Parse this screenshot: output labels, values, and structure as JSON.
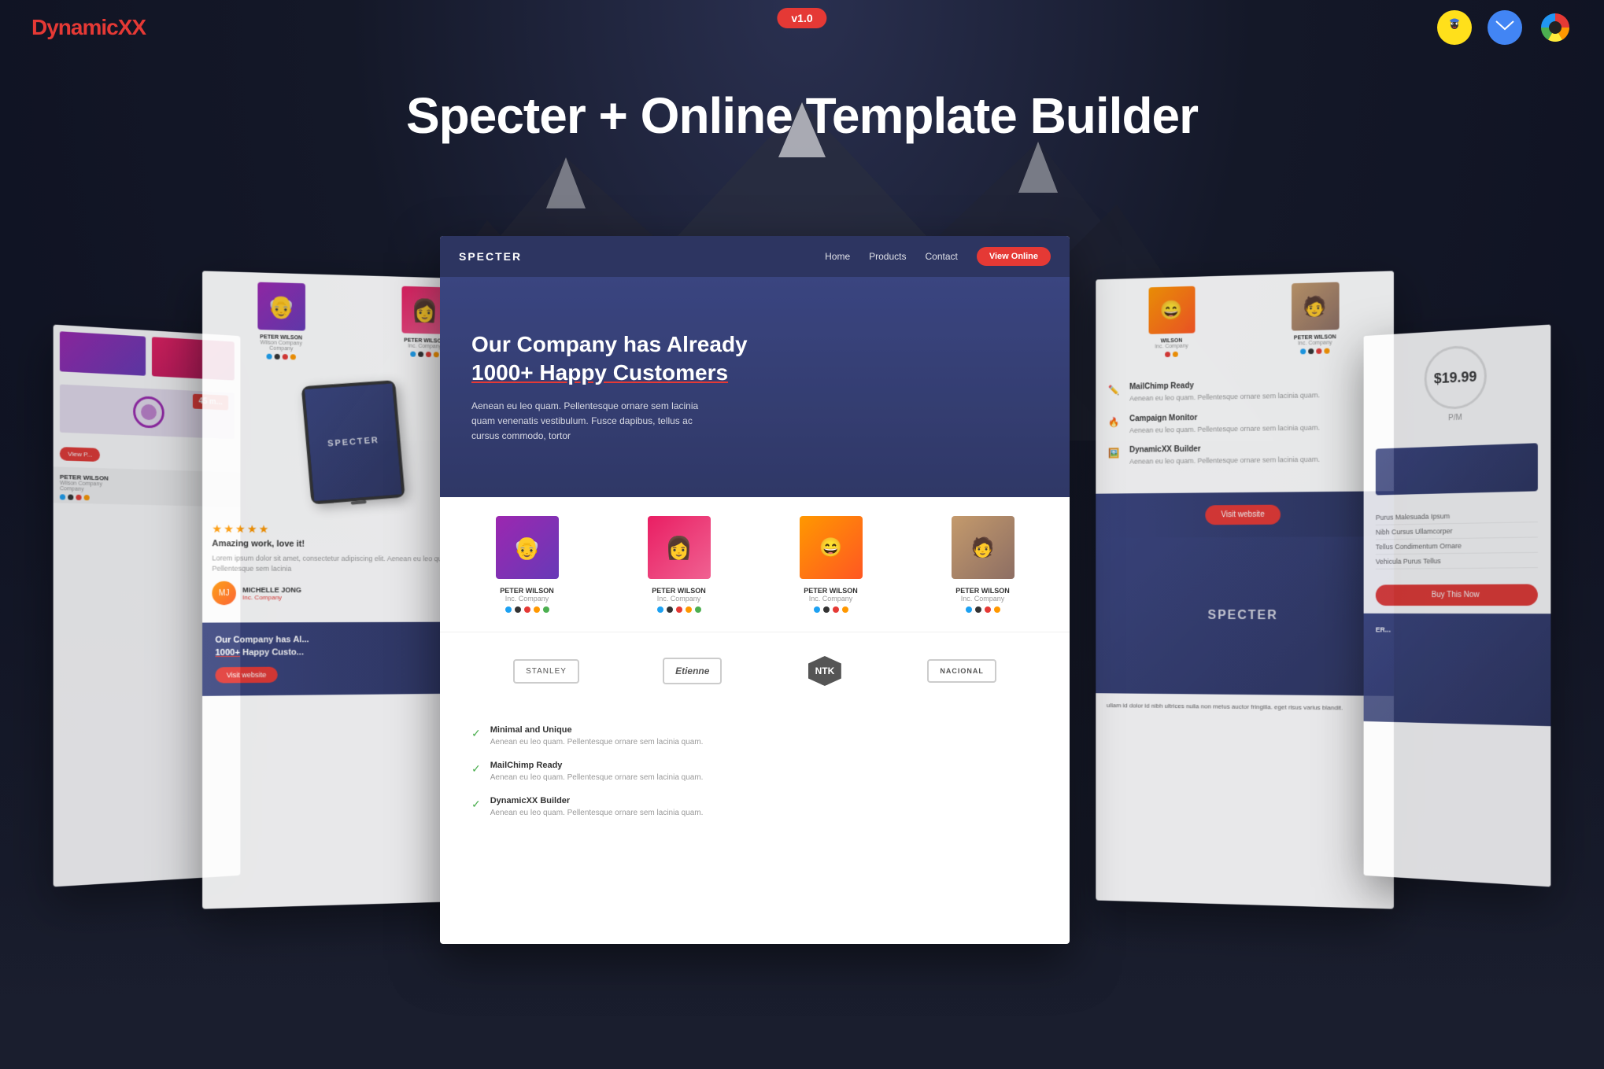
{
  "header": {
    "logo_prefix": "Dynamic",
    "logo_suffix": "XX",
    "version": "v1.0"
  },
  "main_title": "Specter + Online Template Builder",
  "center_card": {
    "nav": {
      "logo": "SPECTER",
      "links": [
        "Home",
        "Products",
        "Contact"
      ],
      "cta": "View Online"
    },
    "hero": {
      "title_line1": "Our Company has Already",
      "title_line2": "1000+ Happy Customers",
      "text": "Aenean eu leo quam. Pellentesque ornare sem lacinia quam venenatis vestibulum. Fusce dapibus, tellus ac cursus commodo, tortor"
    },
    "team": [
      {
        "name": "PETER WILSON",
        "company": "Inc. Company"
      },
      {
        "name": "PETER WILSON",
        "company": "Inc. Company"
      },
      {
        "name": "PETER WILSON",
        "company": "Inc. Company"
      },
      {
        "name": "PETER WILSON",
        "company": "Inc. Company"
      }
    ],
    "brands": [
      "STANLEY",
      "Etienne",
      "NTK",
      "NACIONAL"
    ],
    "features": [
      {
        "title": "Minimal and Unique",
        "text": "Aenean eu leo quam. Pellentesque ornare sem lacinia quam."
      },
      {
        "title": "MailChimp Ready",
        "text": "Aenean eu leo quam. Pellentesque ornare sem lacinia quam."
      },
      {
        "title": "DynamicXX Builder",
        "text": "Aenean eu leo quam. Pellentesque ornare sem lacinia quam."
      }
    ]
  },
  "left_card": {
    "review": {
      "stars": "★★★★★",
      "title": "Amazing work, love it!",
      "text": "Lorem ipsum dolor sit amet, consectetur adipiscing elit. Aenean eu leo quam. Pellentesque sem lacinia",
      "reviewer_name": "MICHELLE JONG",
      "reviewer_company": "Inc. Company"
    },
    "footer": {
      "title_line1": "Our Company has Al...",
      "title_line2": "1000+ Happy Custo...",
      "btn": "Visit website"
    }
  },
  "right_card": {
    "features": [
      {
        "icon": "✏️",
        "title": "MailChimp Ready",
        "text": "Aenean eu leo quam. Pellentesque ornare sem lacinia quam."
      },
      {
        "icon": "🔥",
        "title": "Campaign Monitor",
        "text": "Aenean eu leo quam. Pellentesque ornare sem lacinia quam."
      },
      {
        "icon": "🖼️",
        "title": "DynamicXX Builder",
        "text": "Aenean eu leo quam. Pellentesque ornare sem lacinia quam."
      }
    ],
    "btn": "Visit website",
    "device_label": "SPECTER"
  },
  "far_right_card": {
    "price": "$19.99",
    "period": "P/M",
    "features": [
      "Purus Malesuada Ipsum",
      "Nibh Cursus Ullamcorper",
      "Tellus Condimentum Ornare",
      "Vehicula Purus Tellus"
    ],
    "buy_btn": "Buy This Now"
  }
}
